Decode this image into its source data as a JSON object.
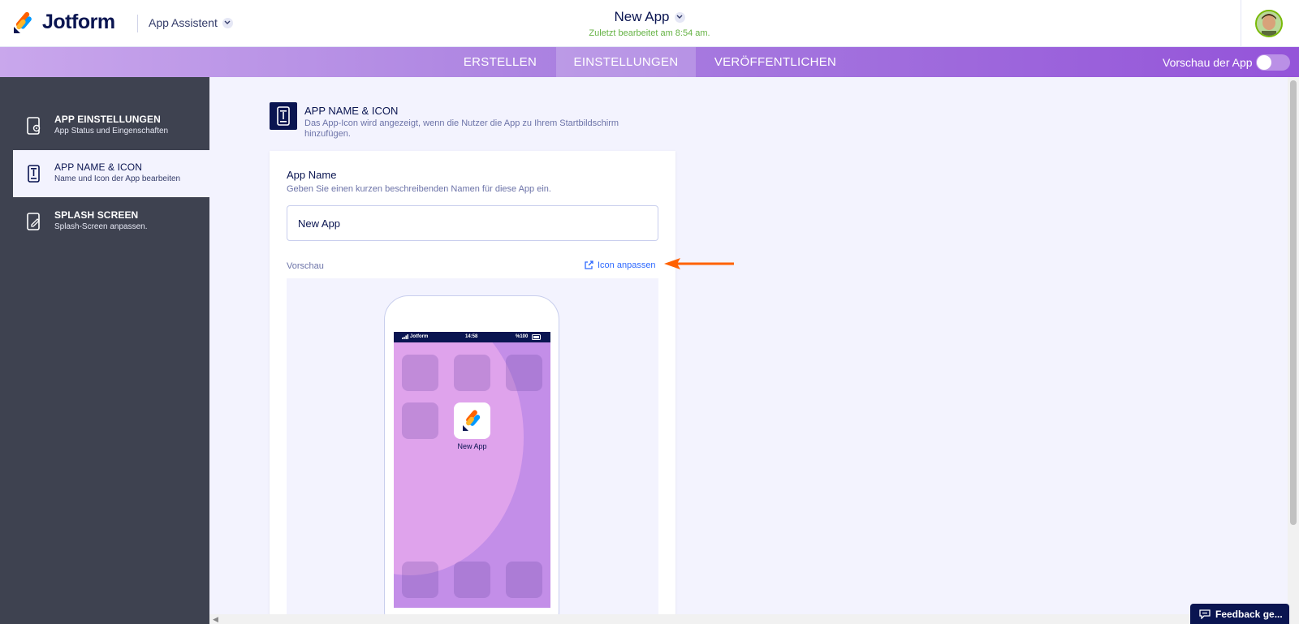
{
  "header": {
    "brand": "Jotform",
    "app_switcher": "App Assistent",
    "doc_title": "New App",
    "last_saved": "Zuletzt bearbeitet am 8:54 am."
  },
  "nav": {
    "tabs": [
      {
        "label": "ERSTELLEN",
        "active": false
      },
      {
        "label": "EINSTELLUNGEN",
        "active": true
      },
      {
        "label": "VERÖFFENTLICHEN",
        "active": false
      }
    ],
    "preview_label": "Vorschau der App",
    "preview_enabled": false
  },
  "sidebar": {
    "items": [
      {
        "title": "APP EINSTELLUNGEN",
        "subtitle": "App Status und Eingenschaften",
        "icon": "settings-doc-icon",
        "active": false
      },
      {
        "title": "APP NAME & ICON",
        "subtitle": "Name und Icon der App bearbeiten",
        "icon": "app-name-icon",
        "active": true
      },
      {
        "title": "SPLASH SCREEN",
        "subtitle": "Splash-Screen anpassen.",
        "icon": "edit-doc-icon",
        "active": false
      }
    ]
  },
  "section": {
    "title": "APP NAME & ICON",
    "description": "Das App-Icon wird angezeigt, wenn die Nutzer die App zu Ihrem Startbildschirm hinzufügen."
  },
  "form": {
    "app_name_label": "App Name",
    "app_name_help": "Geben Sie einen kurzen beschreibenden Namen für diese App ein.",
    "app_name_value": "New App",
    "preview_label": "Vorschau",
    "customize_icon_link": "Icon anpassen"
  },
  "phone_preview": {
    "carrier": "Jotform",
    "time": "14:58",
    "battery": "%100",
    "app_label": "New App"
  },
  "colors": {
    "brand_navy": "#0a1551",
    "nav_gradient_start": "#c9a7ec",
    "nav_gradient_end": "#9454d9",
    "sidebar_bg": "#3e4250",
    "link_blue": "#2e69ff",
    "saved_green": "#64b243",
    "arrow_orange": "#ff6100"
  },
  "feedback_button": "Feedback ge..."
}
